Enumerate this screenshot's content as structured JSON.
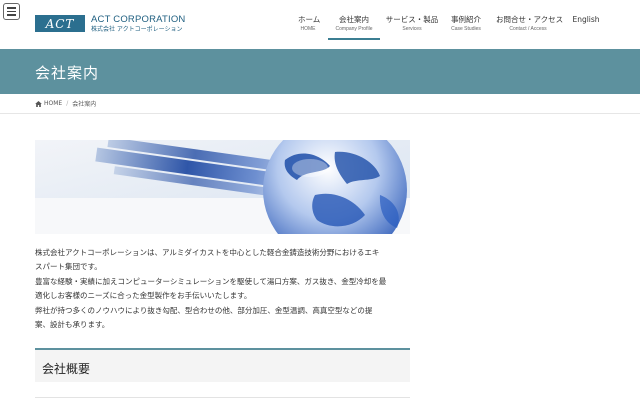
{
  "header": {
    "logo_mark": "ACT",
    "logo_en": "ACT CORPORATION",
    "logo_ja": "株式会社 アクトコーポレーション"
  },
  "nav": [
    {
      "ja": "ホーム",
      "en": "HOME"
    },
    {
      "ja": "会社案内",
      "en": "Company Profile"
    },
    {
      "ja": "サービス・製品",
      "en": "Services"
    },
    {
      "ja": "事例紹介",
      "en": "Case Studies"
    },
    {
      "ja": "お問合せ・アクセス",
      "en": "Contact / Access"
    },
    {
      "ja": "English",
      "en": ""
    }
  ],
  "banner": {
    "title": "会社案内"
  },
  "breadcrumb": {
    "home": "HOME",
    "current": "会社案内"
  },
  "intro": [
    "株式会社アクトコーポレーションは、アルミダイカストを中心とした軽合金鋳造技術分野におけるエキ",
    "スパート集団です。",
    "豊富な経験・実績に加えコンピューターシミュレーションを駆使して湯口方案、ガス抜き、金型冷却を最",
    "適化しお客様のニーズに合った金型製作をお手伝いいたします。",
    "弊社が持つ多くのノウハウにより抜き勾配、型合わせの他、部分加圧、金型温調、高真空型などの提",
    "案、設計も承ります。"
  ],
  "section": {
    "title": "会社概要"
  },
  "colors": {
    "banner": "#5d919e",
    "brand": "#2b6f8f"
  }
}
